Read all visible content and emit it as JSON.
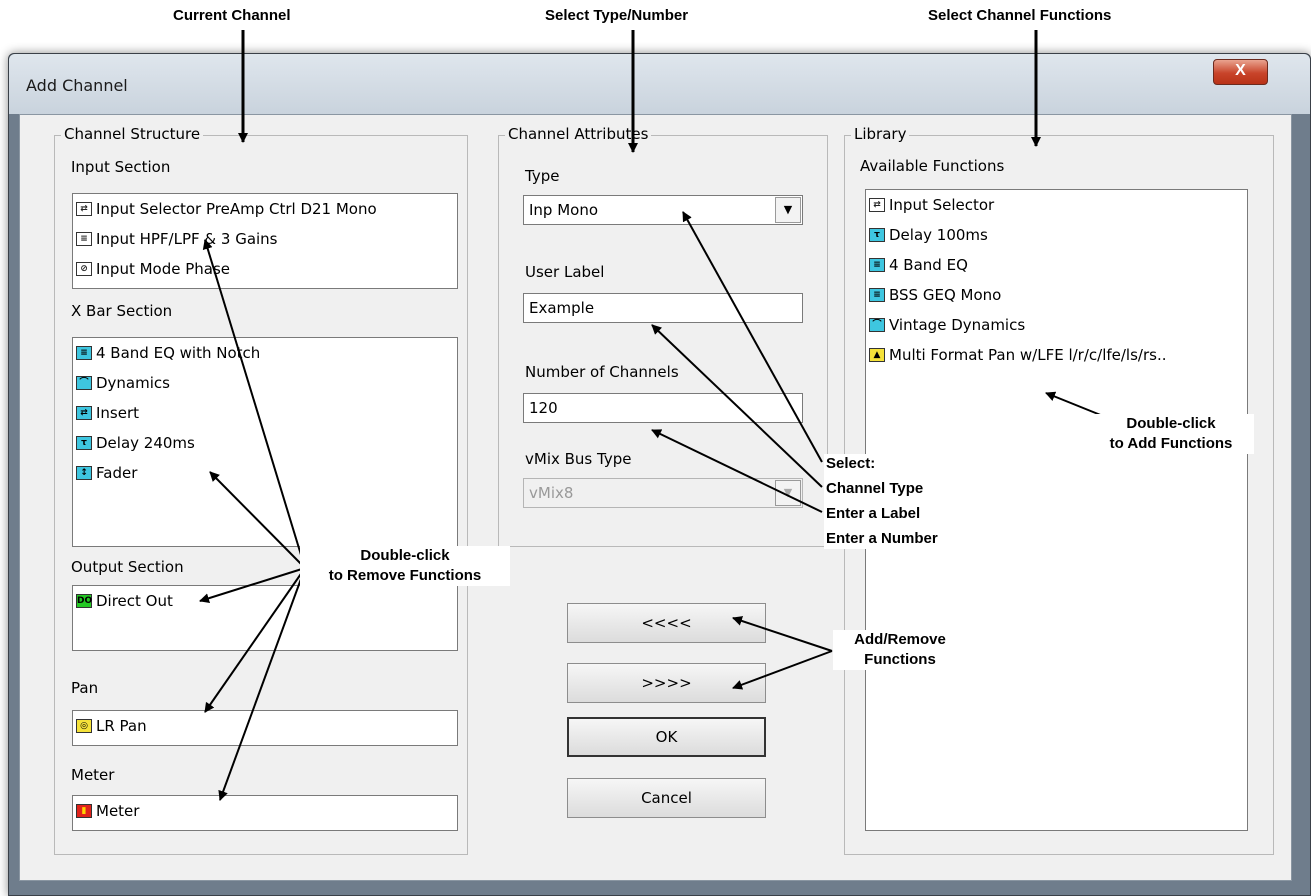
{
  "callouts": {
    "current_channel": "Current Channel",
    "select_type_number": "Select Type/Number",
    "select_channel_functions": "Select Channel Functions",
    "double_click_remove_1": "Double-click",
    "double_click_remove_2": "to Remove Functions",
    "select_line1": "Select:",
    "select_line2": "Channel Type",
    "select_line3": "Enter a Label",
    "select_line4": "Enter a Number",
    "add_remove_1": "Add/Remove",
    "add_remove_2": "Functions",
    "double_click_add_1": "Double-click",
    "double_click_add_2": "to Add Functions"
  },
  "window": {
    "title": "Add Channel",
    "close_glyph": "X"
  },
  "structure": {
    "group_label": "Channel Structure",
    "input_section": {
      "label": "Input Section",
      "items": [
        {
          "label": "Input Selector PreAmp Ctrl D21 Mono",
          "icon": "input-selector-icon",
          "glyph": "⇄",
          "color": "white"
        },
        {
          "label": "Input HPF/LPF & 3 Gains",
          "icon": "hpf-lpf-gains-icon",
          "glyph": "≡",
          "color": "white"
        },
        {
          "label": "Input Mode Phase",
          "icon": "mode-phase-icon",
          "glyph": "⊘",
          "color": "white"
        }
      ]
    },
    "xbar_section": {
      "label": "X Bar Section",
      "items": [
        {
          "label": "4 Band EQ with Notch",
          "icon": "eq-icon",
          "glyph": "≡",
          "color": "cyan"
        },
        {
          "label": "Dynamics",
          "icon": "dynamics-icon",
          "glyph": "⌒",
          "color": "cyan"
        },
        {
          "label": "Insert",
          "icon": "insert-icon",
          "glyph": "⇄",
          "color": "cyan"
        },
        {
          "label": "Delay 240ms",
          "icon": "delay-icon",
          "glyph": "τ",
          "color": "cyan"
        },
        {
          "label": "Fader",
          "icon": "fader-icon",
          "glyph": "↕",
          "color": "cyan"
        }
      ]
    },
    "output_section": {
      "label": "Output Section",
      "items": [
        {
          "label": "Direct Out",
          "icon": "direct-out-icon",
          "glyph": "DO",
          "color": "green"
        }
      ]
    },
    "pan": {
      "label": "Pan",
      "items": [
        {
          "label": "LR Pan",
          "icon": "lr-pan-icon",
          "glyph": "◎",
          "color": "yellow"
        }
      ]
    },
    "meter": {
      "label": "Meter",
      "items": [
        {
          "label": "Meter",
          "icon": "meter-icon",
          "glyph": "▮",
          "color": "red"
        }
      ]
    }
  },
  "attributes": {
    "group_label": "Channel Attributes",
    "type_label": "Type",
    "type_value": "Inp Mono",
    "user_label_label": "User Label",
    "user_label_value": "Example",
    "num_channels_label": "Number of Channels",
    "num_channels_value": "120",
    "vmix_label": "vMix Bus Type",
    "vmix_value": "vMix8",
    "dropdown_glyph": "▼"
  },
  "buttons": {
    "remove": "<<<<",
    "add": ">>>>",
    "ok": "OK",
    "cancel": "Cancel"
  },
  "library": {
    "group_label": "Library",
    "available_label": "Available Functions",
    "items": [
      {
        "label": "Input Selector",
        "icon": "input-selector-icon",
        "glyph": "⇄",
        "color": "white"
      },
      {
        "label": "Delay 100ms",
        "icon": "delay-icon",
        "glyph": "τ",
        "color": "cyan"
      },
      {
        "label": "4 Band EQ",
        "icon": "eq-icon",
        "glyph": "≡",
        "color": "cyan"
      },
      {
        "label": "BSS GEQ Mono",
        "icon": "geq-icon",
        "glyph": "≡",
        "color": "cyan"
      },
      {
        "label": "Vintage Dynamics",
        "icon": "dynamics-icon",
        "glyph": "⌒",
        "color": "cyan"
      },
      {
        "label": "Multi Format Pan w/LFE l/r/c/lfe/ls/rs..",
        "icon": "multi-pan-icon",
        "glyph": "▲",
        "color": "yellow"
      }
    ]
  }
}
